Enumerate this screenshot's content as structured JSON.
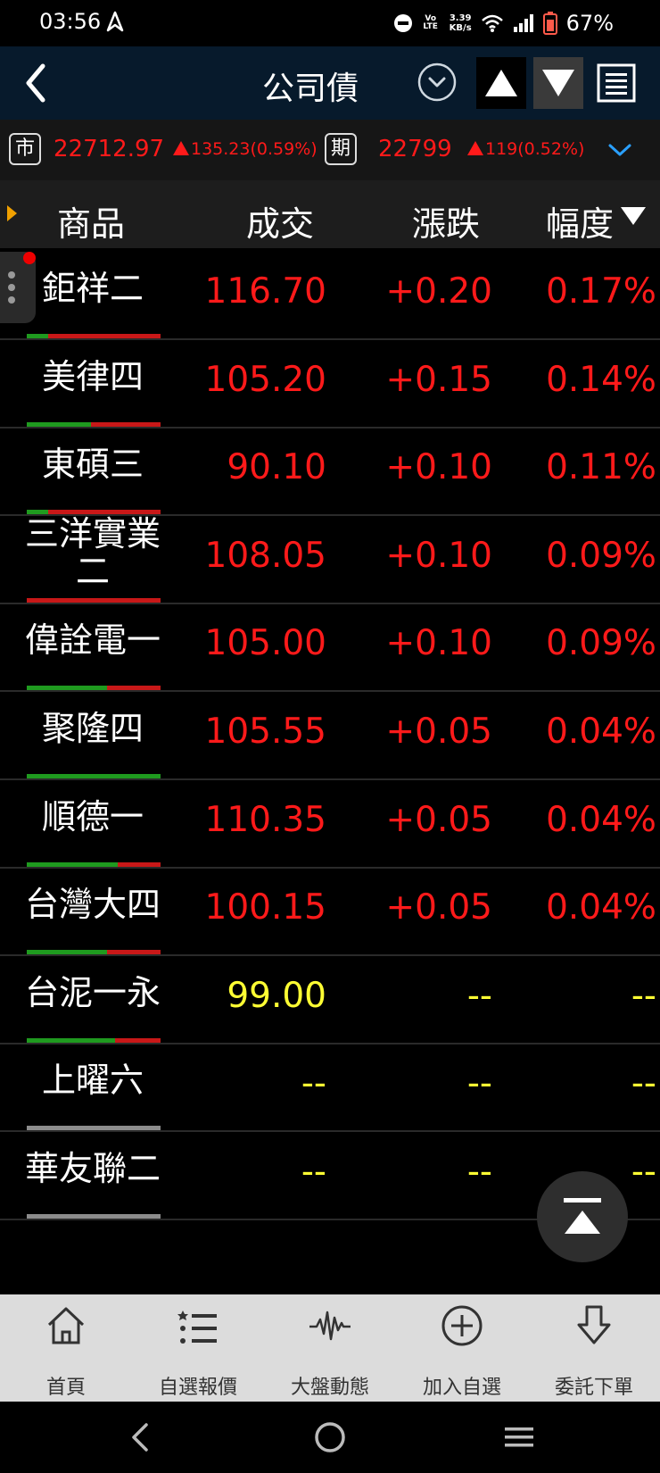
{
  "status_bar": {
    "time": "03:56",
    "volte": "Vo LTE",
    "speed_value": "3.39",
    "speed_unit": "KB/s",
    "battery": "67%"
  },
  "header": {
    "title": "公司債"
  },
  "index_bar": {
    "spot": {
      "badge": "市",
      "value": "22712.97",
      "change": "135.23(0.59%)"
    },
    "futures": {
      "badge": "期",
      "value": "22799",
      "change": "119(0.52%)"
    }
  },
  "columns": {
    "product": "商品",
    "price": "成交",
    "change": "漲跌",
    "percent": "幅度"
  },
  "colors": {
    "up": "#ff1a1a",
    "flat": "#ffff33",
    "bar_green": "#1f9a1f",
    "bar_red": "#c81818",
    "bar_gray": "#8c8c8c",
    "header_bg": "#071a2c"
  },
  "rows": [
    {
      "name": "鉅祥二",
      "price": "116.70",
      "change": "+0.20",
      "percent": "0.17%",
      "price_color": "red",
      "change_color": "red",
      "bar_green": 0.16,
      "bar_gray": 0
    },
    {
      "name": "美律四",
      "price": "105.20",
      "change": "+0.15",
      "percent": "0.14%",
      "price_color": "red",
      "change_color": "red",
      "bar_green": 0.48,
      "bar_gray": 0
    },
    {
      "name": "東碩三",
      "price": "90.10",
      "change": "+0.10",
      "percent": "0.11%",
      "price_color": "red",
      "change_color": "red",
      "bar_green": 0.16,
      "bar_gray": 0
    },
    {
      "name": "三洋實業二",
      "price": "108.05",
      "change": "+0.10",
      "percent": "0.09%",
      "price_color": "red",
      "change_color": "red",
      "bar_green": 0,
      "bar_gray": 0
    },
    {
      "name": "偉詮電一",
      "price": "105.00",
      "change": "+0.10",
      "percent": "0.09%",
      "price_color": "red",
      "change_color": "red",
      "bar_green": 0.6,
      "bar_gray": 0
    },
    {
      "name": "聚隆四",
      "price": "105.55",
      "change": "+0.05",
      "percent": "0.04%",
      "price_color": "red",
      "change_color": "red",
      "bar_green": 1,
      "bar_gray": 0
    },
    {
      "name": "順德一",
      "price": "110.35",
      "change": "+0.05",
      "percent": "0.04%",
      "price_color": "red",
      "change_color": "red",
      "bar_green": 0.68,
      "bar_gray": 0
    },
    {
      "name": "台灣大四",
      "price": "100.15",
      "change": "+0.05",
      "percent": "0.04%",
      "price_color": "red",
      "change_color": "red",
      "bar_green": 0.6,
      "bar_gray": 0
    },
    {
      "name": "台泥一永",
      "price": "99.00",
      "change": "--",
      "percent": "--",
      "price_color": "yellow",
      "change_color": "yellow",
      "bar_green": 0.66,
      "bar_gray": 0
    },
    {
      "name": "上曜六",
      "price": "--",
      "change": "--",
      "percent": "--",
      "price_color": "yellow",
      "change_color": "yellow",
      "bar_green": 0,
      "bar_gray": 1
    },
    {
      "name": "華友聯二",
      "price": "--",
      "change": "--",
      "percent": "--",
      "price_color": "yellow",
      "change_color": "yellow",
      "bar_green": 0,
      "bar_gray": 1
    }
  ],
  "bottom_nav": [
    {
      "label": "首頁",
      "icon": "home-icon"
    },
    {
      "label": "自選報價",
      "icon": "watchlist-icon"
    },
    {
      "label": "大盤動態",
      "icon": "pulse-icon"
    },
    {
      "label": "加入自選",
      "icon": "add-circle-icon"
    },
    {
      "label": "委託下單",
      "icon": "order-down-icon"
    }
  ]
}
